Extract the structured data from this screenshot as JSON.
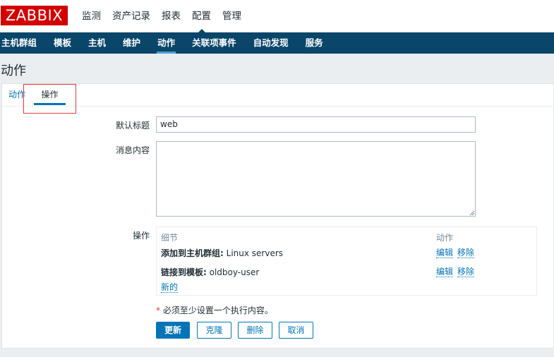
{
  "logo": "ZABBIX",
  "main_nav": [
    "监测",
    "资产记录",
    "报表",
    "配置",
    "管理"
  ],
  "sub_nav": [
    "主机群组",
    "模板",
    "主机",
    "维护",
    "动作",
    "关联项事件",
    "自动发现",
    "服务"
  ],
  "page_title": "动作",
  "tabs": [
    "动作",
    "操作"
  ],
  "form": {
    "default_subject_label": "默认标题",
    "default_subject_value": "web",
    "message_label": "消息内容",
    "message_value": "",
    "operations_label": "操作"
  },
  "operations": {
    "col_details": "细节",
    "col_actions": "动作",
    "rows": [
      {
        "label": "添加到主机群组:",
        "value": " Linux servers",
        "edit": "编辑",
        "remove": "移除"
      },
      {
        "label": "链接到模板:",
        "value": " oldboy-user",
        "edit": "编辑",
        "remove": "移除"
      }
    ],
    "new_link": "新的"
  },
  "note": {
    "star": "*",
    "text": " 必须至少设置一个执行内容。"
  },
  "buttons": {
    "update": "更新",
    "clone": "克隆",
    "delete": "删除",
    "cancel": "取消"
  },
  "colors": {
    "brand": "#d40000",
    "nav": "#0a466a",
    "accent": "#0275b8"
  }
}
